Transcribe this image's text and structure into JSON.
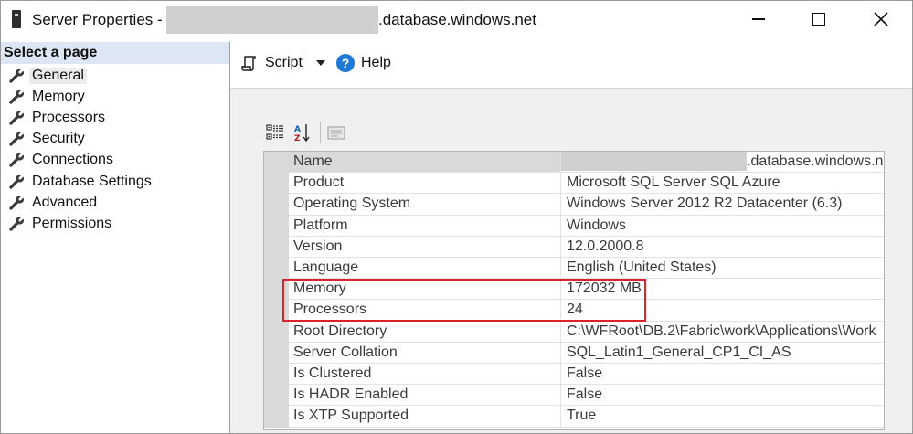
{
  "window": {
    "title_prefix": "Server Properties -",
    "title_suffix": ".database.windows.net"
  },
  "left_pane": {
    "header": "Select a page",
    "items": [
      {
        "label": "General"
      },
      {
        "label": "Memory"
      },
      {
        "label": "Processors"
      },
      {
        "label": "Security"
      },
      {
        "label": "Connections"
      },
      {
        "label": "Database Settings"
      },
      {
        "label": "Advanced"
      },
      {
        "label": "Permissions"
      }
    ]
  },
  "toolbar": {
    "script_label": "Script",
    "help_label": "Help"
  },
  "grid": {
    "rows": [
      {
        "name": "Name",
        "value": ".database.windows.n"
      },
      {
        "name": "Product",
        "value": "Microsoft SQL Server SQL Azure"
      },
      {
        "name": "Operating System",
        "value": "Windows Server 2012 R2 Datacenter (6.3)"
      },
      {
        "name": "Platform",
        "value": "Windows"
      },
      {
        "name": "Version",
        "value": "12.0.2000.8"
      },
      {
        "name": "Language",
        "value": "English (United States)"
      },
      {
        "name": "Memory",
        "value": "172032 MB"
      },
      {
        "name": "Processors",
        "value": "24"
      },
      {
        "name": "Root Directory",
        "value": "C:\\WFRoot\\DB.2\\Fabric\\work\\Applications\\Work"
      },
      {
        "name": "Server Collation",
        "value": "SQL_Latin1_General_CP1_CI_AS"
      },
      {
        "name": "Is Clustered",
        "value": "False"
      },
      {
        "name": "Is HADR Enabled",
        "value": "False"
      },
      {
        "name": "Is XTP Supported",
        "value": "True"
      }
    ]
  },
  "colors": {
    "highlight": "#d9242b",
    "header_bg": "#dce6f4",
    "help_icon": "#1e7ad6"
  }
}
